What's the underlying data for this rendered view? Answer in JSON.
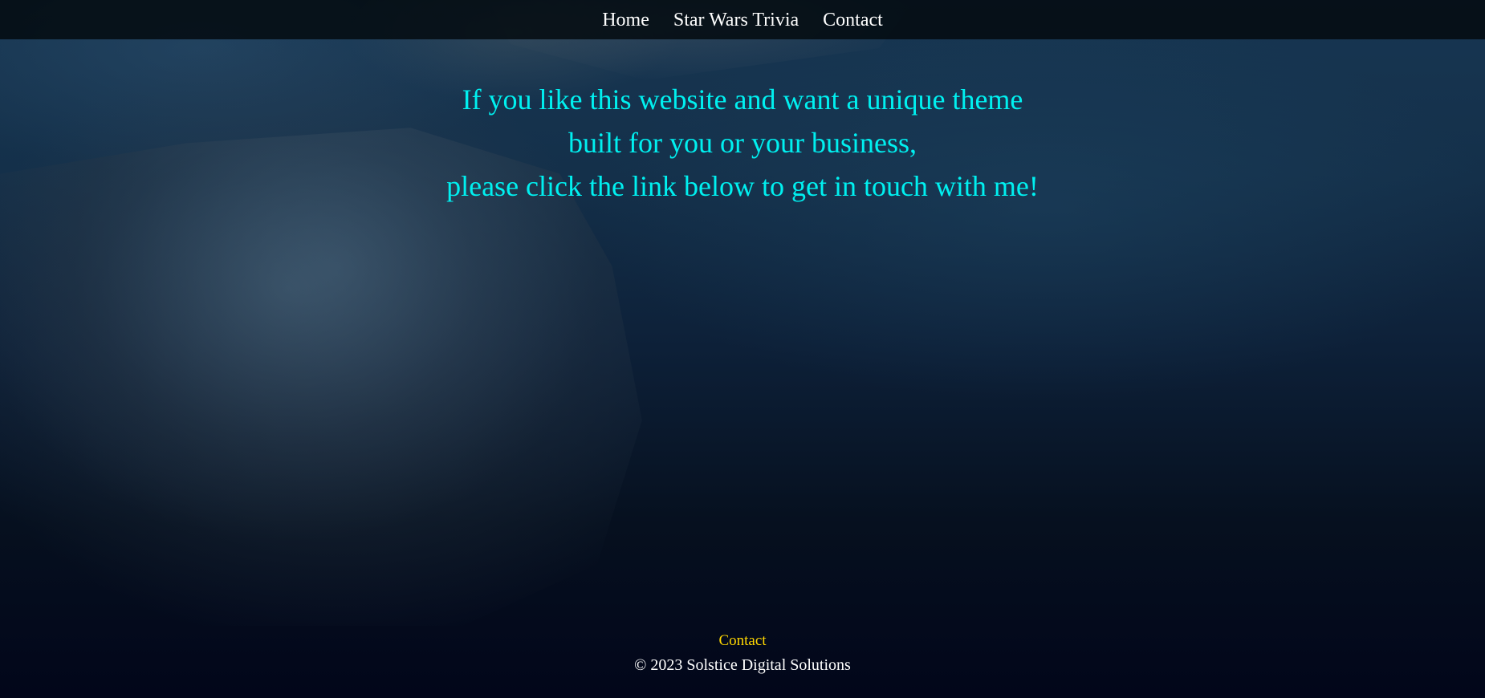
{
  "nav": {
    "items": [
      {
        "label": "Home"
      },
      {
        "label": "Star Wars Trivia"
      },
      {
        "label": "Contact"
      }
    ]
  },
  "main": {
    "message_lines": [
      "If you like this website and want a unique theme",
      "built for you or your business,",
      "please click the link below to get in touch with me!"
    ]
  },
  "footer": {
    "contact_label": "Contact",
    "copyright": "© 2023 Solstice Digital Solutions"
  },
  "colors": {
    "message_text": "#00f0f0",
    "footer_link": "#ffd700",
    "nav_text": "#ffffff"
  }
}
